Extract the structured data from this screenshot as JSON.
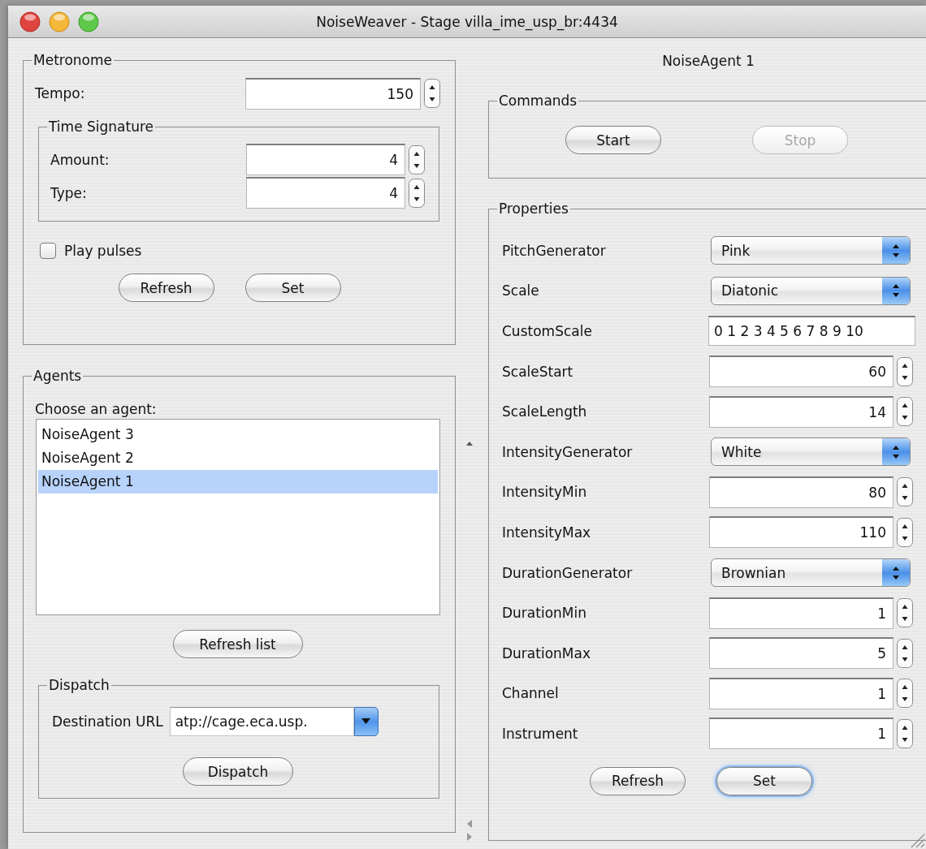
{
  "window": {
    "title": "NoiseWeaver - Stage villa_ime_usp_br:4434"
  },
  "metronome": {
    "title": "Metronome",
    "tempo": {
      "label": "Tempo:",
      "value": "150"
    },
    "time_signature": {
      "title": "Time Signature",
      "fields": [
        {
          "label": "Amount:",
          "value": "4"
        },
        {
          "label": "Type:",
          "value": "4"
        }
      ]
    },
    "play_pulses": {
      "label": "Play pulses",
      "checked": false
    },
    "buttons": [
      {
        "label": "Refresh"
      },
      {
        "label": "Set"
      }
    ]
  },
  "agents": {
    "title": "Agents",
    "prompt": "Choose an agent:",
    "items": [
      {
        "label": "NoiseAgent 3",
        "selected": false
      },
      {
        "label": "NoiseAgent 2",
        "selected": false
      },
      {
        "label": "NoiseAgent 1",
        "selected": true
      }
    ],
    "refresh_button": "Refresh list",
    "dispatch": {
      "title": "Dispatch",
      "url_label": "Destination URL",
      "url_value": "atp://cage.eca.usp.",
      "button": "Dispatch"
    }
  },
  "agent_panel": {
    "title": "NoiseAgent 1",
    "commands": {
      "title": "Commands",
      "buttons": [
        {
          "label": "Start",
          "disabled": false
        },
        {
          "label": "Stop",
          "disabled": true
        }
      ]
    },
    "properties": {
      "title": "Properties",
      "rows": [
        {
          "kind": "select",
          "label": "PitchGenerator",
          "value": "Pink"
        },
        {
          "kind": "select",
          "label": "Scale",
          "value": "Diatonic"
        },
        {
          "kind": "text",
          "label": "CustomScale",
          "value": "0 1 2 3 4 5 6 7 8 9 10"
        },
        {
          "kind": "spinner",
          "label": "ScaleStart",
          "value": "60"
        },
        {
          "kind": "spinner",
          "label": "ScaleLength",
          "value": "14"
        },
        {
          "kind": "select",
          "label": "IntensityGenerator",
          "value": "White"
        },
        {
          "kind": "spinner",
          "label": "IntensityMin",
          "value": "80"
        },
        {
          "kind": "spinner",
          "label": "IntensityMax",
          "value": "110"
        },
        {
          "kind": "select",
          "label": "DurationGenerator",
          "value": "Brownian"
        },
        {
          "kind": "spinner",
          "label": "DurationMin",
          "value": "1"
        },
        {
          "kind": "spinner",
          "label": "DurationMax",
          "value": "5"
        },
        {
          "kind": "spinner",
          "label": "Channel",
          "value": "1"
        },
        {
          "kind": "spinner",
          "label": "Instrument",
          "value": "1"
        }
      ],
      "buttons": [
        {
          "label": "Refresh",
          "focused": false
        },
        {
          "label": "Set",
          "focused": true
        }
      ]
    }
  }
}
